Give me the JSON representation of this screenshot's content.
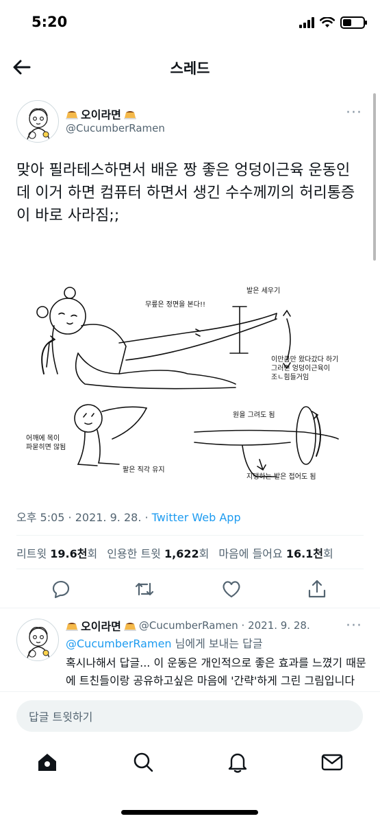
{
  "status_bar": {
    "time": "5:20",
    "icons": [
      "signal-icon",
      "wifi-icon",
      "battery-icon"
    ]
  },
  "nav": {
    "back_icon": "arrow-left-icon",
    "title": "스레드"
  },
  "tweet": {
    "author_name": "오이라면",
    "author_emoji": "pudding",
    "handle": "@CucumberRamen",
    "more": "···",
    "text": "맞아 필라테스하면서 배운 짱 좋은 엉덩이근육 운동인데 이거 하면 컴퓨터 하면서 생긴 수수께끼의 허리통증이 바로 사라짐;;",
    "illustration_labels": {
      "knee": "무릎은 정면을 본다!!",
      "foot": "발은 세우기",
      "range_1": "이만큼만 왔다갔다 하기",
      "range_2": "그러면 엉덩이근육이",
      "range_3": "조ㄴ힘들거임",
      "shoulder_1": "어깨에 목이",
      "shoulder_2": "파묻히면 않됨",
      "circle": "원을 그려도 됨",
      "arm": "팔은 직각 유지",
      "support_foot": "지탱하는 발은 접어도 됨"
    },
    "meta_time": "오후 5:05 · 2021. 9. 28. · ",
    "meta_app": "Twitter Web App",
    "stats": {
      "retweets_label": "리트윗",
      "retweets_value": "19.6천",
      "retweets_unit": "회",
      "quotes_label": "인용한 트윗",
      "quotes_value": "1,622",
      "quotes_unit": "회",
      "likes_label": "마음에 들어요",
      "likes_value": "16.1천",
      "likes_unit": "회"
    },
    "actions": [
      "reply-icon",
      "retweet-icon",
      "like-icon",
      "share-icon"
    ]
  },
  "reply": {
    "author_name": "오이라면",
    "handle_date": "@CucumberRamen · 2021. 9. 28.",
    "more": "···",
    "reply_to_mention": "@CucumberRamen",
    "reply_to_suffix": " 님에게 보내는 답글",
    "text": "혹시나해서 답글... 이 운동은 개인적으로 좋은 효과를 느꼈기 때문에 트친들이랑 공유하고싶은 마음에 '간략'하게 그린 그림입니다 혹시 맞지 않을수도 있으니 이게 정보가 생각을 하고 하시고 요"
  },
  "composer": {
    "placeholder": "답글 트윗하기"
  },
  "tabbar": {
    "items": [
      "home-icon",
      "search-icon",
      "notifications-icon",
      "messages-icon"
    ]
  },
  "colors": {
    "accent": "#1d9bf0",
    "text": "#0f1419",
    "secondary": "#536471",
    "divider": "#eff3f4"
  }
}
